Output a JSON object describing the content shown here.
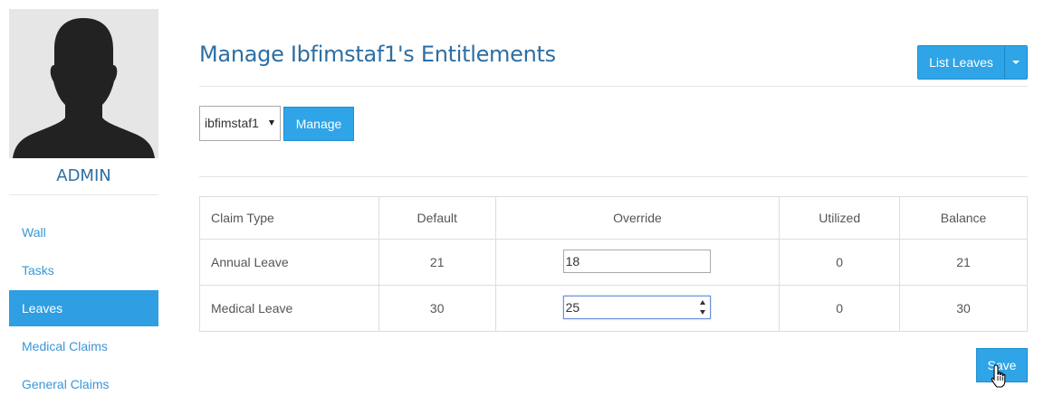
{
  "sidebar": {
    "username": "ADMIN",
    "nav_items": [
      {
        "label": "Wall"
      },
      {
        "label": "Tasks"
      },
      {
        "label": "Leaves"
      },
      {
        "label": "Medical Claims"
      },
      {
        "label": "General Claims"
      }
    ],
    "active_item": "Leaves",
    "avatar_icon": "user-silhouette-icon"
  },
  "header": {
    "title": "Manage Ibfimstaf1's Entitlements",
    "list_button_label": "List Leaves"
  },
  "employee_picker": {
    "selected_value": "ibfimstaf1",
    "manage_label": "Manage"
  },
  "table": {
    "columns": [
      "Claim Type",
      "Default",
      "Override",
      "Utilized",
      "Balance"
    ],
    "rows": [
      {
        "claim_type": "Annual Leave",
        "default": "21",
        "override": "18",
        "utilized": "0",
        "balance": "21"
      },
      {
        "claim_type": "Medical Leave",
        "default": "30",
        "override": "25",
        "utilized": "0",
        "balance": "30"
      }
    ]
  },
  "footer": {
    "save_label": "Save"
  },
  "colors": {
    "primary": "#2fa4e7",
    "title": "#2d6ea3",
    "link": "#3a96d6"
  }
}
